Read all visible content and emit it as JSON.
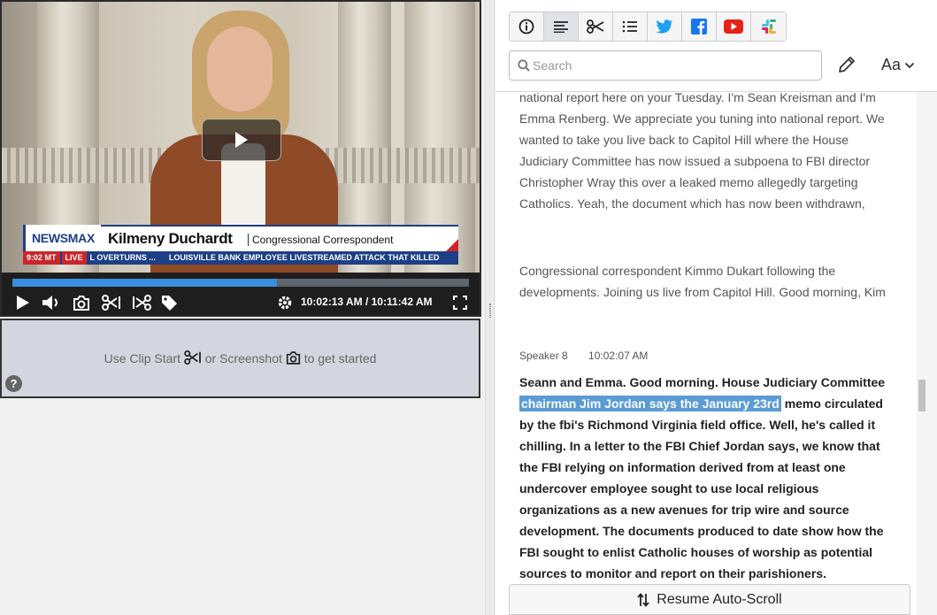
{
  "video": {
    "lower_third": {
      "logo": "NEWSMAX",
      "name": "Kilmeny Duchardt",
      "title": "Congressional Correspondent",
      "time": "9:02 MT",
      "live": "LIVE",
      "ticker": "L OVERTURNS ...      LOUISVILLE BANK EMPLOYEE LIVESTREAMED ATTACK THAT KILLED"
    },
    "progress_fraction": 0.58,
    "current_time": "10:02:13 AM",
    "duration": "10:11:42 AM",
    "time_separator": "/"
  },
  "clip_panel": {
    "hint_prefix": "Use Clip Start",
    "hint_middle": "or Screenshot",
    "hint_suffix": "to get started",
    "help": "?"
  },
  "toolbar": {
    "buttons": [
      "info-icon",
      "transcript-icon",
      "scissors-icon",
      "list-icon",
      "twitter-icon",
      "facebook-icon",
      "youtube-icon",
      "slack-icon"
    ],
    "active": "transcript-icon"
  },
  "search": {
    "placeholder": "Search"
  },
  "font_button": "Aa",
  "transcript": {
    "para1": "national report here on your Tuesday. I'm Sean Kreisman and I'm Emma Renberg. We appreciate you tuning into national report. We wanted to take you live back to Capitol Hill where the House Judiciary Committee has now issued a subpoena to FBI director Christopher Wray this over a leaked memo allegedly targeting Catholics. Yeah, the document which has now been withdrawn,",
    "para2": "Congressional correspondent Kimmo Dukart following the developments. Joining us live from Capitol Hill. Good morning, Kim",
    "speaker": "Speaker 8",
    "speaker_time": "10:02:07 AM",
    "para3_before": "Seann and Emma. Good morning. House Judiciary Committee ",
    "para3_highlight": "chairman Jim Jordan says the January 23rd",
    "para3_after": " memo circulated by the fbi's Richmond Virginia field office. Well, he's called it chilling. In a letter to the FBI Chief Jordan says, we know that the FBI relying on information derived from at least one undercover employee sought to use local religious organizations as a new avenues for trip wire and source development. The documents produced to date show how the FBI sought to enlist Catholic houses of worship as potential sources to monitor and report on their parishioners."
  },
  "resume_button": "Resume Auto-Scroll",
  "colors": {
    "accent": "#3a8ee0",
    "highlight": "#5b9bd5",
    "newsmax_blue": "#1d3f85",
    "newsmax_red": "#c8262b"
  }
}
